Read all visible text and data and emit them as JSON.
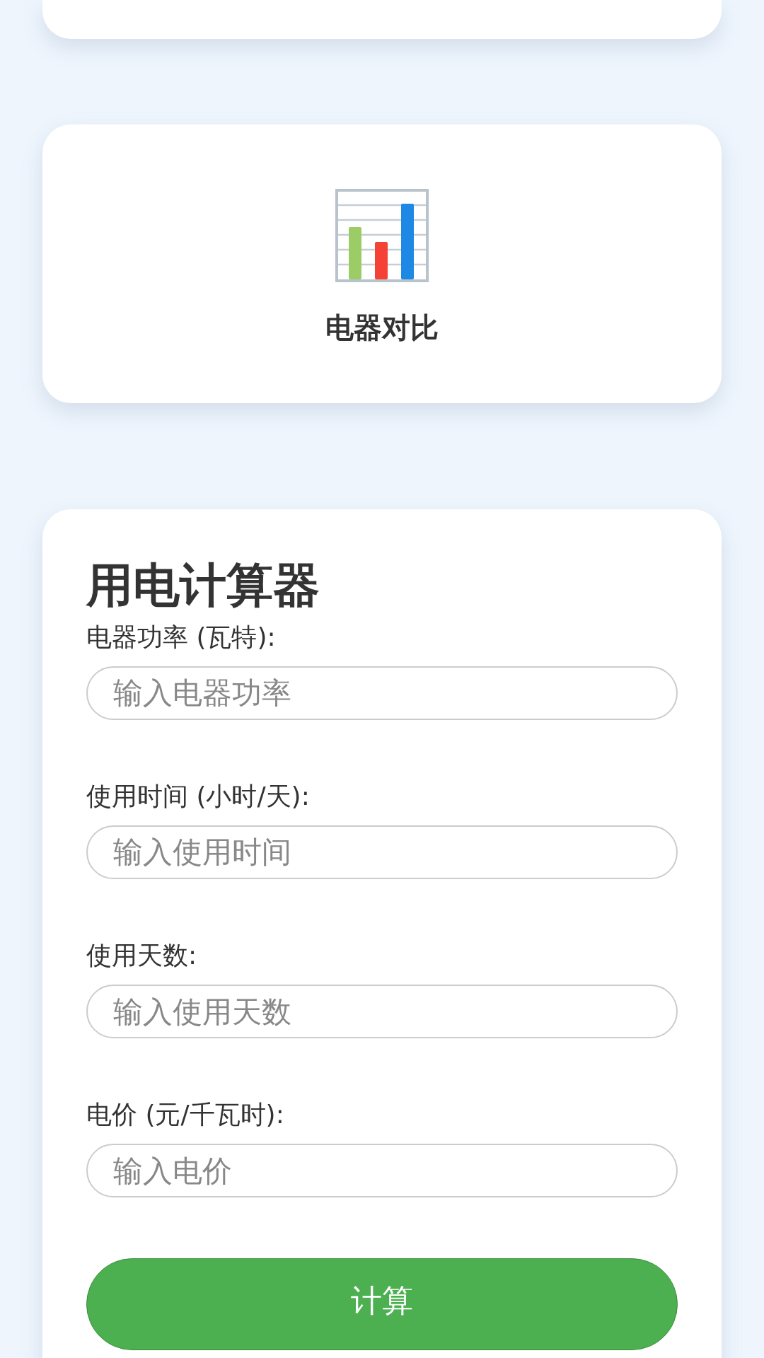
{
  "feature_card": {
    "title": "电器对比"
  },
  "calculator": {
    "title": "用电计算器",
    "fields": [
      {
        "label": "电器功率 (瓦特):",
        "placeholder": "输入电器功率"
      },
      {
        "label": "使用时间 (小时/天):",
        "placeholder": "输入使用时间"
      },
      {
        "label": "使用天数:",
        "placeholder": "输入使用天数"
      },
      {
        "label": "电价 (元/千瓦时):",
        "placeholder": "输入电价"
      }
    ],
    "button": "计算"
  }
}
